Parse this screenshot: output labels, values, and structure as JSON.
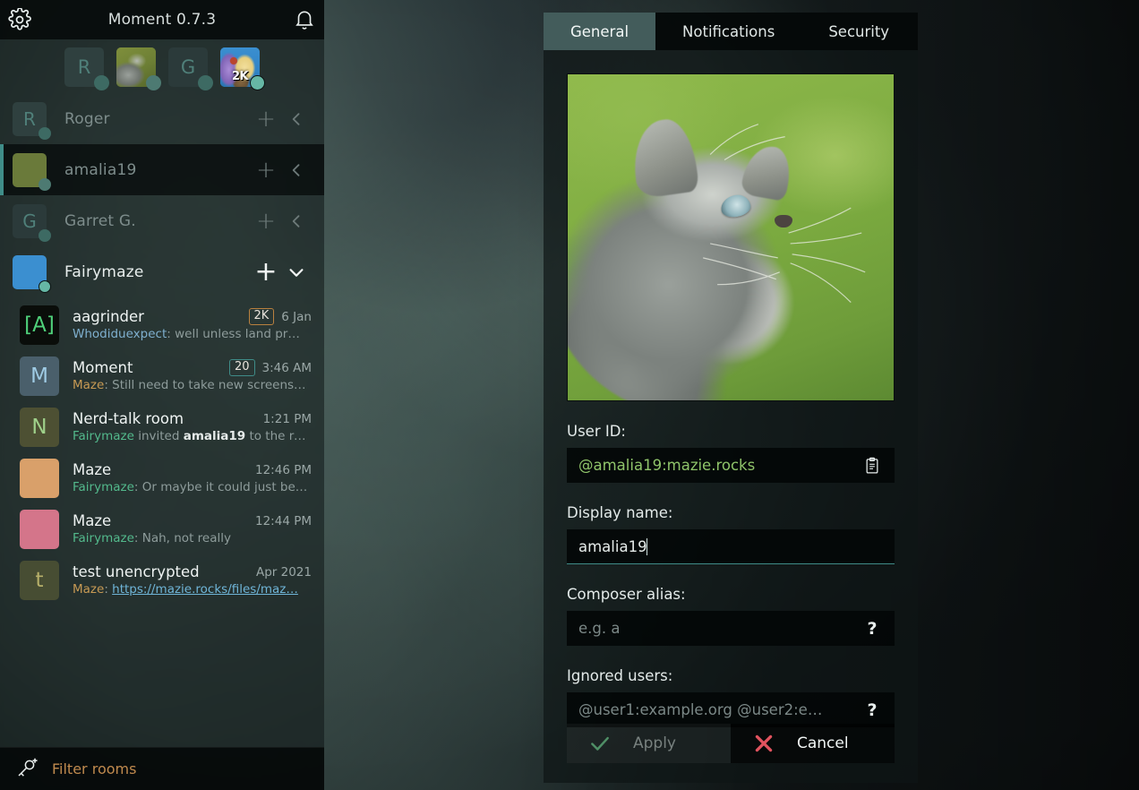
{
  "app": {
    "title": "Moment 0.7.3",
    "gear_icon": "gear-icon",
    "bell_icon": "bell-icon"
  },
  "sidebar": {
    "account_strip": [
      {
        "initial": "R",
        "type": "letter",
        "bg": "#2f403f",
        "fg": "#4f7f79",
        "presence": "#3d6a63"
      },
      {
        "initial": "",
        "type": "photo-cat",
        "bg": "#6a7a3a",
        "fg": "#cfd3cd",
        "presence": "#4d7a72"
      },
      {
        "initial": "G",
        "type": "letter",
        "bg": "#2b3a3a",
        "fg": "#4f7f79",
        "presence": "#3d6a63"
      },
      {
        "initial": "",
        "type": "photo-anime",
        "bg": "#3b8fd0",
        "fg": "#ffffff",
        "presence": "#66b7a5",
        "badge": "2K"
      }
    ],
    "accounts": [
      {
        "name": "Roger",
        "initial": "R",
        "type": "letter",
        "bg": "#2f403f",
        "fg": "#4f7f79",
        "presence": "#3d6a63",
        "selected": false,
        "active": false,
        "plus": "+",
        "chevron": "chevron-left-icon"
      },
      {
        "name": "amalia19",
        "initial": "",
        "type": "photo-cat",
        "bg": "#6a7a3a",
        "fg": "#cfd3cd",
        "presence": "#4d7a72",
        "selected": true,
        "active": false,
        "plus": "+",
        "chevron": "chevron-left-icon"
      },
      {
        "name": "Garret G.",
        "initial": "G",
        "type": "letter",
        "bg": "#2b3a3a",
        "fg": "#4f7f79",
        "presence": "#3d6a63",
        "selected": false,
        "active": false,
        "plus": "+",
        "chevron": "chevron-left-icon"
      },
      {
        "name": "Fairymaze",
        "initial": "",
        "type": "photo-anime",
        "bg": "#3b8fd0",
        "fg": "#ffffff",
        "presence": "#66b7a5",
        "selected": false,
        "active": true,
        "plus": "+",
        "chevron": "chevron-down-icon"
      }
    ],
    "rooms": [
      {
        "name": "aagrinder",
        "avatar_text": "[A]",
        "avatar_bg": "#0a0d0a",
        "avatar_fg": "#4fd07a",
        "unread": "2K",
        "unread_style": "amber",
        "time": "6 Jan",
        "preview_sender": "Whodiduexpect",
        "preview_sender_style": "blue",
        "preview_text": ": well unless land pr…"
      },
      {
        "name": "Moment",
        "avatar_text": "M",
        "avatar_bg": "#4a5f6b",
        "avatar_fg": "#9fcbe4",
        "unread": "20",
        "unread_style": "teal",
        "time": "3:46 AM",
        "preview_sender": "Maze",
        "preview_sender_style": "amber",
        "preview_text": ": Still need to take new screens…"
      },
      {
        "name": "Nerd-talk room",
        "avatar_text": "N",
        "avatar_bg": "#4d5033",
        "avatar_fg": "#9fd08a",
        "unread": "",
        "unread_style": "",
        "time": "1:21 PM",
        "preview_sender": "Fairymaze",
        "preview_sender_style": "green",
        "preview_text": " invited ",
        "preview_mention": "amalia19",
        "preview_tail": " to the ro…"
      },
      {
        "name": "Maze",
        "avatar_text": "",
        "avatar_bg": "#d9a06a",
        "avatar_fg": "#ffffff",
        "avatar_kind": "pony-a",
        "unread": "",
        "unread_style": "",
        "time": "12:46 PM",
        "preview_sender": "Fairymaze",
        "preview_sender_style": "green",
        "preview_text": ": Or maybe it could just be…"
      },
      {
        "name": "Maze",
        "avatar_text": "",
        "avatar_bg": "#d4758a",
        "avatar_fg": "#ffffff",
        "avatar_kind": "pony-b",
        "unread": "",
        "unread_style": "",
        "time": "12:44 PM",
        "preview_sender": "Fairymaze",
        "preview_sender_style": "green",
        "preview_text": ": Nah, not really"
      },
      {
        "name": "test unencrypted",
        "avatar_text": "t",
        "avatar_bg": "#474d33",
        "avatar_fg": "#b7b06a",
        "unread": "",
        "unread_style": "",
        "time": "Apr 2021",
        "preview_sender": "Maze",
        "preview_sender_style": "amber",
        "preview_text": ": ",
        "preview_link": "https://mazie.rocks/files/maz…"
      }
    ],
    "filter": {
      "placeholder": "Filter rooms",
      "icon": "add-account-key-icon"
    }
  },
  "settings": {
    "tabs": [
      {
        "label": "General",
        "active": true
      },
      {
        "label": "Notifications",
        "active": false
      },
      {
        "label": "Security",
        "active": false
      }
    ],
    "avatar_alt": "profile-avatar-kitten",
    "fields": [
      {
        "label": "User ID:",
        "value": "@amalia19:mazie.rocks",
        "placeholder": "",
        "kind": "userid",
        "readonly": true,
        "action_icon": "clipboard-icon",
        "focused": false
      },
      {
        "label": "Display name:",
        "value": "amalia19",
        "placeholder": "",
        "kind": "text",
        "readonly": false,
        "action_icon": "",
        "focused": true
      },
      {
        "label": "Composer alias:",
        "value": "",
        "placeholder": "e.g. a",
        "kind": "text",
        "readonly": false,
        "action_icon": "?",
        "focused": false
      },
      {
        "label": "Ignored users:",
        "value": "",
        "placeholder": "@user1:example.org @user2:e…",
        "kind": "text",
        "readonly": false,
        "action_icon": "?",
        "focused": false
      }
    ],
    "actions": {
      "apply_label": "Apply",
      "apply_icon": "check-icon",
      "apply_enabled": false,
      "cancel_label": "Cancel",
      "cancel_icon": "cross-icon"
    }
  },
  "colors": {
    "accent_teal": "#3f8c88",
    "presence_online": "#66b7a5",
    "tab_active_bg": "#435c5b",
    "userid_green": "#8fc46a",
    "cancel_red": "#e2535f",
    "apply_check_green": "#4f8f66",
    "filter_amber": "#c08a4e",
    "badge_amber": "#b9813f"
  }
}
